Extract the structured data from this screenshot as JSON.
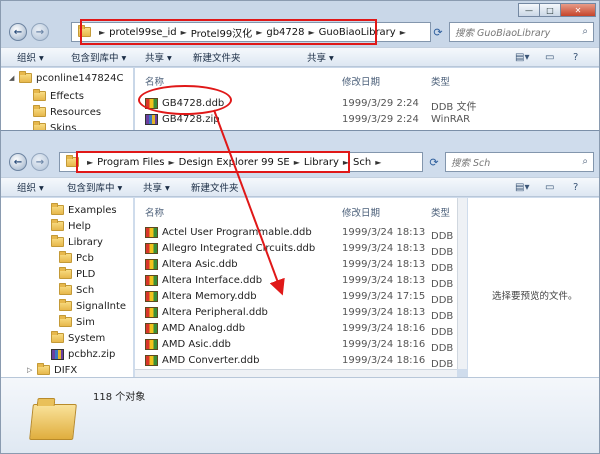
{
  "back_window": {
    "address_crumbs": [
      "protel99se_id",
      "Protel99汉化",
      "gb4728",
      "GuoBiaoLibrary"
    ],
    "search_placeholder": "搜索 GuoBiaoLibrary",
    "toolbar": {
      "organize": "组织 ▾",
      "include": "包含到库中 ▾",
      "share": "共享 ▾",
      "new_folder": "新建文件夹",
      "share2": "共享 ▾"
    },
    "tree": [
      "pconline147824C",
      "Effects",
      "Resources",
      "Skins"
    ],
    "columns": {
      "name": "名称",
      "modified": "修改日期",
      "type": "类型"
    },
    "files": [
      {
        "name": "GB4728.ddb",
        "date": "1999/3/29 2:24",
        "type": "DDB 文件",
        "icon": "ddb-icon"
      },
      {
        "name": "GB4728.zip",
        "date": "1999/3/29 2:24",
        "type": "WinRAR",
        "icon": "zip-icon"
      }
    ]
  },
  "front_window": {
    "address_crumbs": [
      "Program Files",
      "Design Explorer 99 SE",
      "Library",
      "Sch"
    ],
    "search_placeholder": "搜索 Sch",
    "toolbar": {
      "organize": "组织 ▾",
      "include": "包含到库中 ▾",
      "share": "共享 ▾",
      "new_folder": "新建文件夹"
    },
    "tree": [
      {
        "label": "Examples",
        "indent": 1
      },
      {
        "label": "Help",
        "indent": 1
      },
      {
        "label": "Library",
        "indent": 1
      },
      {
        "label": "Pcb",
        "indent": 2
      },
      {
        "label": "PLD",
        "indent": 2
      },
      {
        "label": "Sch",
        "indent": 2
      },
      {
        "label": "SignalInte",
        "indent": 2
      },
      {
        "label": "Sim",
        "indent": 2
      },
      {
        "label": "System",
        "indent": 1
      },
      {
        "label": "pcbhz.zip",
        "indent": 1
      },
      {
        "label": "DIFX",
        "indent": 0
      }
    ],
    "columns": {
      "name": "名称",
      "modified": "修改日期",
      "type": "类型"
    },
    "files": [
      {
        "name": "Actel User Programmable.ddb",
        "date": "1999/3/24 18:13",
        "type": "DDB 文"
      },
      {
        "name": "Allegro Integrated Circuits.ddb",
        "date": "1999/3/24 18:13",
        "type": "DDB 文"
      },
      {
        "name": "Altera Asic.ddb",
        "date": "1999/3/24 18:13",
        "type": "DDB 文"
      },
      {
        "name": "Altera Interface.ddb",
        "date": "1999/3/24 18:13",
        "type": "DDB 文"
      },
      {
        "name": "Altera Memory.ddb",
        "date": "1999/3/24 17:15",
        "type": "DDB 文"
      },
      {
        "name": "Altera Peripheral.ddb",
        "date": "1999/3/24 18:13",
        "type": "DDB 文"
      },
      {
        "name": "AMD Analog.ddb",
        "date": "1999/3/24 18:16",
        "type": "DDB 文"
      },
      {
        "name": "AMD Asic.ddb",
        "date": "1999/3/24 18:16",
        "type": "DDB 文"
      },
      {
        "name": "AMD Converter.ddb",
        "date": "1999/3/24 18:16",
        "type": "DDB 文"
      }
    ],
    "preview_text": "选择要预览的文件。",
    "status_count": "118 个对象"
  },
  "colors": {
    "annotation_red": "#e01818"
  }
}
